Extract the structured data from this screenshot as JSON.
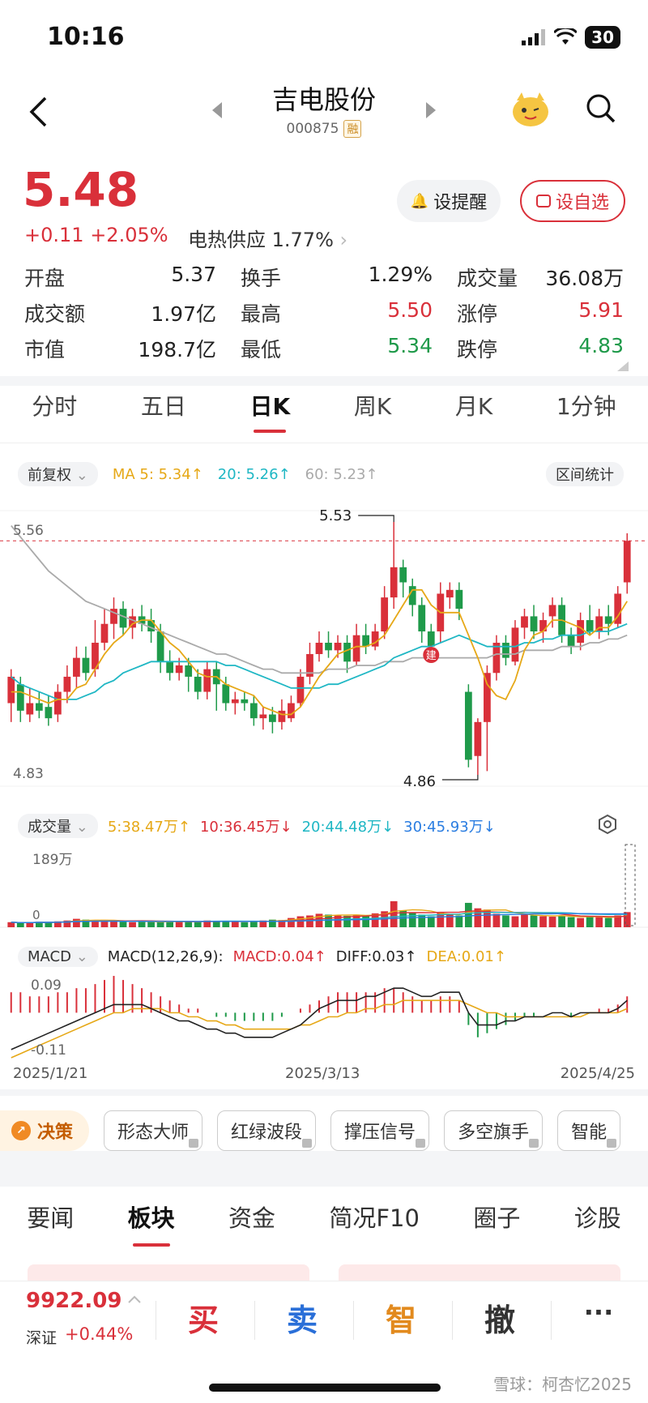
{
  "status_bar": {
    "time": "10:16",
    "battery": "30"
  },
  "nav": {
    "title": "吉电股份",
    "code": "000875",
    "badge": "融"
  },
  "quote": {
    "price": "5.48",
    "change": "+0.11",
    "change_pct": "+2.05%",
    "sector_name": "电热供应",
    "sector_pct": "1.77%",
    "remind_label": "设提醒",
    "watch_label": "设自选"
  },
  "stats": [
    [
      {
        "label": "开盘",
        "value": "5.37",
        "color": "neutral"
      },
      {
        "label": "换手",
        "value": "1.29%",
        "color": "neutral"
      },
      {
        "label": "成交量",
        "value": "36.08万",
        "color": "neutral"
      }
    ],
    [
      {
        "label": "成交额",
        "value": "1.97亿",
        "color": "neutral"
      },
      {
        "label": "最高",
        "value": "5.50",
        "color": "red"
      },
      {
        "label": "涨停",
        "value": "5.91",
        "color": "red"
      }
    ],
    [
      {
        "label": "市值",
        "value": "198.7亿",
        "color": "neutral"
      },
      {
        "label": "最低",
        "value": "5.34",
        "color": "green"
      },
      {
        "label": "跌停",
        "value": "4.83",
        "color": "green"
      }
    ]
  ],
  "chart_tabs": [
    "分时",
    "五日",
    "日K",
    "周K",
    "月K",
    "1分钟"
  ],
  "chart_tab_active": 2,
  "kline_controls": {
    "adjust": "前复权",
    "ma5": "MA 5: 5.34↑",
    "ma20": "20: 5.26↑",
    "ma60": "60: 5.23↑",
    "range_stats": "区间统计",
    "y_top": "5.56",
    "y_bottom": "4.83",
    "high_label": "5.53",
    "low_label": "4.86",
    "marker": "建"
  },
  "volume_controls": {
    "label": "成交量",
    "v5": "5:38.47万↑",
    "v10": "10:36.45万↓",
    "v20": "20:44.48万↓",
    "v30": "30:45.93万↓",
    "y_top": "189万",
    "y_bottom": "0"
  },
  "macd_controls": {
    "label": "MACD",
    "params": "MACD(12,26,9):",
    "macd": "MACD:0.04↑",
    "diff": "DIFF:0.03↑",
    "dea": "DEA:0.01↑",
    "y_top": "0.09",
    "y_bottom": "-0.11"
  },
  "date_axis": [
    "2025/1/21",
    "2025/3/13",
    "2025/4/25"
  ],
  "tools": {
    "decision": "决策",
    "items": [
      "形态大师",
      "红绿波段",
      "撑压信号",
      "多空旗手",
      "智能"
    ]
  },
  "news_tabs": [
    "要闻",
    "板块",
    "资金",
    "简况F10",
    "圈子",
    "诊股"
  ],
  "news_tab_active": 1,
  "bottom_bar": {
    "index_value": "9922.09",
    "index_name": "深证",
    "index_pct": "+0.44%",
    "buy": "买",
    "sell": "卖",
    "smart": "智",
    "cancel": "撤",
    "more": "···"
  },
  "watermark": "雪球：柯杏忆2025",
  "colors": {
    "up": "#d9303a",
    "down": "#1f9a4a",
    "ma5": "#e6a817",
    "ma20": "#1fb7c4",
    "ma60": "#aaaaaa"
  },
  "chart_data": {
    "type": "candlestick",
    "title": "",
    "x_range": [
      "2025/1/21",
      "2025/4/25"
    ],
    "ylim": [
      4.83,
      5.56
    ],
    "candles": [
      {
        "o": 5.05,
        "c": 5.12,
        "h": 5.14,
        "l": 5.0
      },
      {
        "o": 5.1,
        "c": 5.03,
        "h": 5.12,
        "l": 5.0
      },
      {
        "o": 5.02,
        "c": 5.05,
        "h": 5.09,
        "l": 5.0
      },
      {
        "o": 5.05,
        "c": 5.03,
        "h": 5.08,
        "l": 5.01
      },
      {
        "o": 5.04,
        "c": 5.01,
        "h": 5.07,
        "l": 4.99
      },
      {
        "o": 5.02,
        "c": 5.08,
        "h": 5.1,
        "l": 5.0
      },
      {
        "o": 5.08,
        "c": 5.12,
        "h": 5.15,
        "l": 5.05
      },
      {
        "o": 5.12,
        "c": 5.17,
        "h": 5.2,
        "l": 5.09
      },
      {
        "o": 5.17,
        "c": 5.13,
        "h": 5.2,
        "l": 5.11
      },
      {
        "o": 5.14,
        "c": 5.21,
        "h": 5.27,
        "l": 5.12
      },
      {
        "o": 5.21,
        "c": 5.26,
        "h": 5.3,
        "l": 5.19
      },
      {
        "o": 5.26,
        "c": 5.3,
        "h": 5.33,
        "l": 5.22
      },
      {
        "o": 5.3,
        "c": 5.25,
        "h": 5.32,
        "l": 5.23
      },
      {
        "o": 5.25,
        "c": 5.28,
        "h": 5.3,
        "l": 5.22
      },
      {
        "o": 5.28,
        "c": 5.26,
        "h": 5.31,
        "l": 5.24
      },
      {
        "o": 5.27,
        "c": 5.24,
        "h": 5.3,
        "l": 5.21
      },
      {
        "o": 5.24,
        "c": 5.16,
        "h": 5.26,
        "l": 5.13
      },
      {
        "o": 5.16,
        "c": 5.13,
        "h": 5.19,
        "l": 5.11
      },
      {
        "o": 5.13,
        "c": 5.15,
        "h": 5.17,
        "l": 5.11
      },
      {
        "o": 5.15,
        "c": 5.12,
        "h": 5.17,
        "l": 5.08
      },
      {
        "o": 5.12,
        "c": 5.08,
        "h": 5.14,
        "l": 5.06
      },
      {
        "o": 5.08,
        "c": 5.14,
        "h": 5.16,
        "l": 5.06
      },
      {
        "o": 5.14,
        "c": 5.1,
        "h": 5.16,
        "l": 5.03
      },
      {
        "o": 5.1,
        "c": 5.05,
        "h": 5.12,
        "l": 5.03
      },
      {
        "o": 5.05,
        "c": 5.06,
        "h": 5.08,
        "l": 5.02
      },
      {
        "o": 5.06,
        "c": 5.05,
        "h": 5.08,
        "l": 5.03
      },
      {
        "o": 5.05,
        "c": 5.01,
        "h": 5.07,
        "l": 4.99
      },
      {
        "o": 5.01,
        "c": 5.02,
        "h": 5.04,
        "l": 4.98
      },
      {
        "o": 5.02,
        "c": 5.0,
        "h": 5.04,
        "l": 4.97
      },
      {
        "o": 5.0,
        "c": 5.03,
        "h": 5.06,
        "l": 4.98
      },
      {
        "o": 5.01,
        "c": 5.05,
        "h": 5.07,
        "l": 5.0
      },
      {
        "o": 5.05,
        "c": 5.12,
        "h": 5.14,
        "l": 5.04
      },
      {
        "o": 5.12,
        "c": 5.18,
        "h": 5.21,
        "l": 5.1
      },
      {
        "o": 5.18,
        "c": 5.21,
        "h": 5.24,
        "l": 5.16
      },
      {
        "o": 5.21,
        "c": 5.19,
        "h": 5.24,
        "l": 5.17
      },
      {
        "o": 5.19,
        "c": 5.21,
        "h": 5.23,
        "l": 5.17
      },
      {
        "o": 5.21,
        "c": 5.16,
        "h": 5.23,
        "l": 5.13
      },
      {
        "o": 5.16,
        "c": 5.23,
        "h": 5.26,
        "l": 5.15
      },
      {
        "o": 5.23,
        "c": 5.2,
        "h": 5.26,
        "l": 5.18
      },
      {
        "o": 5.2,
        "c": 5.24,
        "h": 5.26,
        "l": 5.19
      },
      {
        "o": 5.24,
        "c": 5.33,
        "h": 5.36,
        "l": 5.22
      },
      {
        "o": 5.33,
        "c": 5.41,
        "h": 5.53,
        "l": 5.3
      },
      {
        "o": 5.41,
        "c": 5.37,
        "h": 5.43,
        "l": 5.33
      },
      {
        "o": 5.36,
        "c": 5.31,
        "h": 5.38,
        "l": 5.28
      },
      {
        "o": 5.31,
        "c": 5.24,
        "h": 5.33,
        "l": 5.21
      },
      {
        "o": 5.24,
        "c": 5.2,
        "h": 5.26,
        "l": 5.17
      },
      {
        "o": 5.24,
        "c": 5.34,
        "h": 5.37,
        "l": 5.21
      },
      {
        "o": 5.33,
        "c": 5.35,
        "h": 5.37,
        "l": 5.3
      },
      {
        "o": 5.35,
        "c": 5.3,
        "h": 5.37,
        "l": 5.27
      },
      {
        "o": 5.08,
        "c": 4.9,
        "h": 5.1,
        "l": 4.88
      },
      {
        "o": 4.91,
        "c": 5.0,
        "h": 5.01,
        "l": 4.86
      },
      {
        "o": 5.0,
        "c": 5.13,
        "h": 5.15,
        "l": 4.87
      },
      {
        "o": 5.13,
        "c": 5.21,
        "h": 5.23,
        "l": 5.11
      },
      {
        "o": 5.21,
        "c": 5.17,
        "h": 5.23,
        "l": 5.15
      },
      {
        "o": 5.16,
        "c": 5.25,
        "h": 5.27,
        "l": 5.15
      },
      {
        "o": 5.25,
        "c": 5.28,
        "h": 5.3,
        "l": 5.22
      },
      {
        "o": 5.28,
        "c": 5.24,
        "h": 5.31,
        "l": 5.22
      },
      {
        "o": 5.24,
        "c": 5.27,
        "h": 5.29,
        "l": 5.21
      },
      {
        "o": 5.28,
        "c": 5.31,
        "h": 5.33,
        "l": 5.25
      },
      {
        "o": 5.31,
        "c": 5.23,
        "h": 5.33,
        "l": 5.21
      },
      {
        "o": 5.23,
        "c": 5.2,
        "h": 5.25,
        "l": 5.18
      },
      {
        "o": 5.21,
        "c": 5.27,
        "h": 5.29,
        "l": 5.19
      },
      {
        "o": 5.27,
        "c": 5.24,
        "h": 5.31,
        "l": 5.23
      },
      {
        "o": 5.24,
        "c": 5.28,
        "h": 5.3,
        "l": 5.22
      },
      {
        "o": 5.28,
        "c": 5.26,
        "h": 5.31,
        "l": 5.23
      },
      {
        "o": 5.26,
        "c": 5.34,
        "h": 5.36,
        "l": 5.25
      },
      {
        "o": 5.37,
        "c": 5.48,
        "h": 5.5,
        "l": 5.34
      }
    ],
    "ma5": [
      5.08,
      5.08,
      5.07,
      5.06,
      5.05,
      5.06,
      5.06,
      5.09,
      5.1,
      5.14,
      5.18,
      5.21,
      5.23,
      5.26,
      5.27,
      5.27,
      5.24,
      5.21,
      5.19,
      5.16,
      5.13,
      5.12,
      5.12,
      5.1,
      5.09,
      5.08,
      5.07,
      5.04,
      5.03,
      5.02,
      5.02,
      5.04,
      5.08,
      5.12,
      5.15,
      5.18,
      5.19,
      5.2,
      5.2,
      5.21,
      5.23,
      5.27,
      5.31,
      5.35,
      5.35,
      5.31,
      5.29,
      5.29,
      5.29,
      5.23,
      5.17,
      5.1,
      5.07,
      5.06,
      5.11,
      5.19,
      5.23,
      5.24,
      5.27,
      5.27,
      5.26,
      5.25,
      5.23,
      5.25,
      5.25,
      5.28,
      5.32
    ],
    "ma20": [
      5.12,
      5.1,
      5.09,
      5.08,
      5.07,
      5.06,
      5.06,
      5.06,
      5.07,
      5.08,
      5.1,
      5.11,
      5.13,
      5.14,
      5.15,
      5.16,
      5.16,
      5.16,
      5.16,
      5.16,
      5.16,
      5.16,
      5.16,
      5.15,
      5.15,
      5.14,
      5.13,
      5.12,
      5.11,
      5.1,
      5.09,
      5.09,
      5.09,
      5.09,
      5.1,
      5.1,
      5.11,
      5.12,
      5.13,
      5.14,
      5.15,
      5.17,
      5.18,
      5.19,
      5.2,
      5.2,
      5.21,
      5.22,
      5.23,
      5.22,
      5.21,
      5.2,
      5.2,
      5.2,
      5.2,
      5.21,
      5.21,
      5.22,
      5.22,
      5.23,
      5.23,
      5.23,
      5.24,
      5.24,
      5.24,
      5.25,
      5.26
    ],
    "ma60": [
      5.52,
      5.49,
      5.46,
      5.43,
      5.4,
      5.38,
      5.36,
      5.34,
      5.32,
      5.31,
      5.3,
      5.29,
      5.28,
      5.27,
      5.26,
      5.25,
      5.24,
      5.23,
      5.22,
      5.21,
      5.2,
      5.19,
      5.18,
      5.18,
      5.17,
      5.16,
      5.15,
      5.14,
      5.14,
      5.13,
      5.13,
      5.13,
      5.13,
      5.13,
      5.14,
      5.14,
      5.14,
      5.15,
      5.15,
      5.15,
      5.16,
      5.16,
      5.16,
      5.17,
      5.17,
      5.17,
      5.17,
      5.17,
      5.17,
      5.17,
      5.17,
      5.17,
      5.18,
      5.18,
      5.18,
      5.19,
      5.19,
      5.19,
      5.19,
      5.2,
      5.2,
      5.2,
      5.21,
      5.21,
      5.22,
      5.22,
      5.23
    ],
    "volume_wan": [
      12,
      10,
      11,
      13,
      12,
      14,
      16,
      20,
      18,
      16,
      14,
      15,
      13,
      12,
      14,
      13,
      12,
      15,
      14,
      13,
      12,
      16,
      15,
      14,
      13,
      12,
      14,
      16,
      18,
      17,
      22,
      26,
      28,
      32,
      30,
      28,
      27,
      30,
      26,
      33,
      38,
      62,
      40,
      34,
      30,
      26,
      36,
      30,
      28,
      58,
      45,
      42,
      32,
      28,
      26,
      30,
      28,
      26,
      25,
      28,
      24,
      22,
      26,
      24,
      22,
      28,
      36
    ],
    "macd_hist": [
      0.05,
      0.05,
      0.04,
      0.04,
      0.04,
      0.05,
      0.05,
      0.06,
      0.06,
      0.07,
      0.08,
      0.09,
      0.08,
      0.07,
      0.06,
      0.05,
      0.04,
      0.03,
      0.02,
      0.01,
      0.01,
      0.0,
      -0.01,
      -0.01,
      -0.02,
      -0.02,
      -0.02,
      -0.02,
      -0.02,
      -0.01,
      0.0,
      0.01,
      0.02,
      0.03,
      0.04,
      0.05,
      0.05,
      0.05,
      0.05,
      0.05,
      0.06,
      0.06,
      0.05,
      0.04,
      0.03,
      0.03,
      0.04,
      0.04,
      0.03,
      -0.03,
      -0.06,
      -0.05,
      -0.04,
      -0.03,
      -0.02,
      -0.01,
      -0.01,
      0.0,
      0.0,
      0.0,
      -0.01,
      0.0,
      0.0,
      0.01,
      0.01,
      0.02,
      0.04
    ],
    "diff": [
      -0.09,
      -0.08,
      -0.07,
      -0.06,
      -0.05,
      -0.04,
      -0.03,
      -0.02,
      -0.01,
      0.0,
      0.01,
      0.02,
      0.02,
      0.02,
      0.02,
      0.01,
      0.0,
      -0.01,
      -0.02,
      -0.02,
      -0.03,
      -0.04,
      -0.04,
      -0.05,
      -0.05,
      -0.06,
      -0.06,
      -0.06,
      -0.06,
      -0.05,
      -0.04,
      -0.03,
      -0.01,
      0.01,
      0.02,
      0.03,
      0.03,
      0.03,
      0.04,
      0.04,
      0.05,
      0.06,
      0.06,
      0.05,
      0.04,
      0.04,
      0.05,
      0.05,
      0.05,
      0.0,
      -0.03,
      -0.03,
      -0.03,
      -0.02,
      -0.02,
      -0.01,
      -0.01,
      -0.01,
      0.0,
      0.0,
      -0.01,
      0.0,
      0.0,
      0.0,
      0.0,
      0.01,
      0.03
    ],
    "dea": [
      -0.11,
      -0.1,
      -0.09,
      -0.08,
      -0.07,
      -0.06,
      -0.05,
      -0.04,
      -0.03,
      -0.02,
      -0.01,
      0.0,
      0.0,
      0.01,
      0.01,
      0.01,
      0.01,
      0.0,
      0.0,
      -0.01,
      -0.01,
      -0.02,
      -0.02,
      -0.03,
      -0.03,
      -0.04,
      -0.04,
      -0.04,
      -0.04,
      -0.04,
      -0.04,
      -0.03,
      -0.03,
      -0.02,
      -0.01,
      -0.01,
      0.0,
      0.0,
      0.01,
      0.01,
      0.02,
      0.02,
      0.03,
      0.03,
      0.03,
      0.03,
      0.03,
      0.03,
      0.03,
      0.02,
      0.01,
      0.0,
      0.0,
      -0.01,
      -0.01,
      -0.01,
      -0.01,
      -0.01,
      -0.01,
      -0.01,
      -0.01,
      -0.01,
      0.0,
      0.0,
      0.0,
      0.0,
      0.01
    ]
  }
}
